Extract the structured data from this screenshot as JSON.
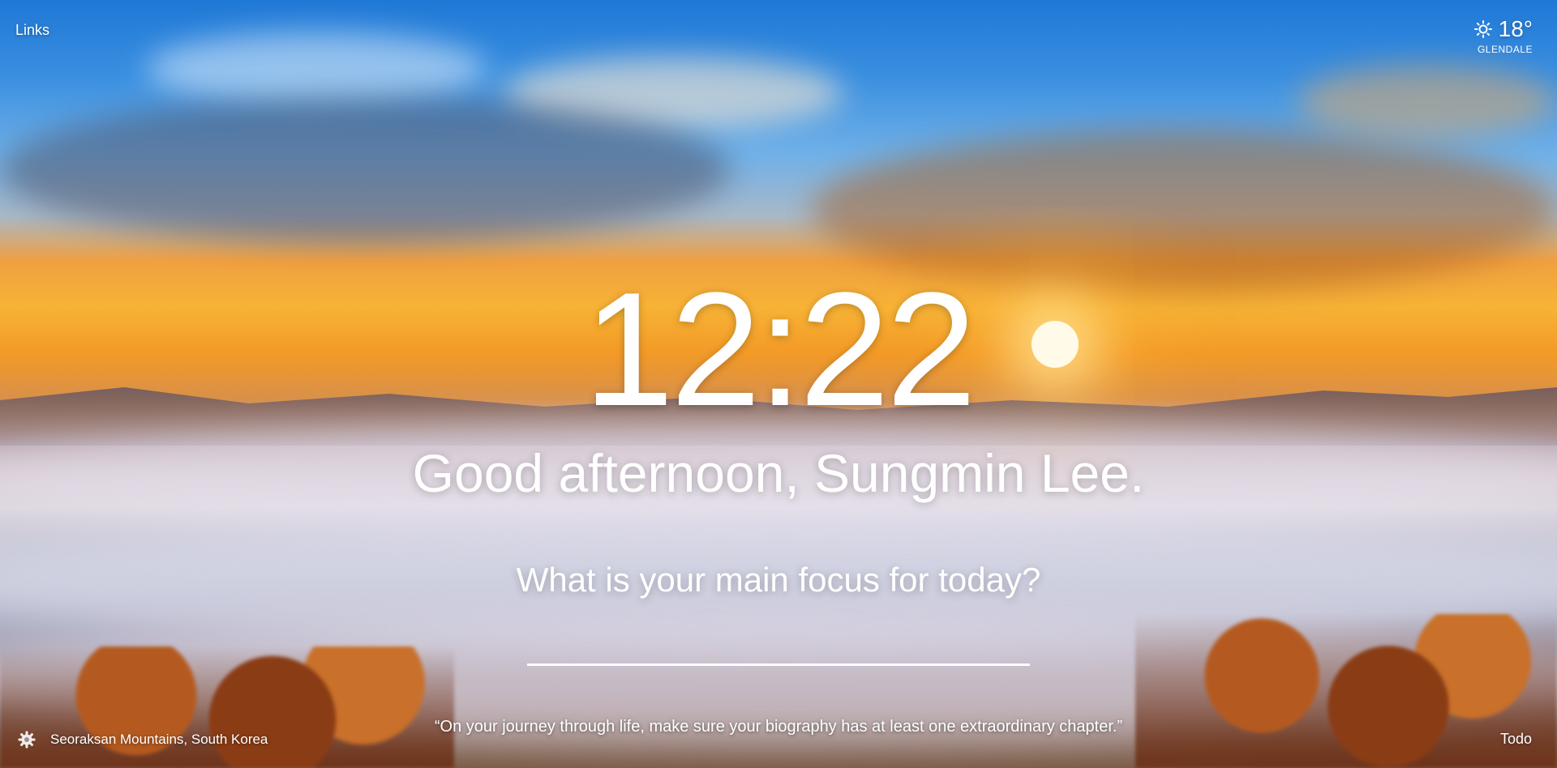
{
  "top_left": {
    "links_label": "Links"
  },
  "weather": {
    "icon": "sun-icon",
    "temperature": "18°",
    "location": "GLENDALE"
  },
  "main": {
    "clock": "12:22",
    "greeting": "Good afternoon, Sungmin Lee.",
    "focus_prompt": "What is your main focus for today?",
    "focus_input_value": ""
  },
  "bottom": {
    "settings_icon": "gear-icon",
    "photo_location": "Seoraksan Mountains, South Korea",
    "quote": "“On your journey through life, make sure your biography has at least one extraordinary chapter.”",
    "todo_label": "Todo"
  },
  "colors": {
    "text": "#ffffff",
    "sky_top": "#1f78d6",
    "sunset": "#f7b335"
  }
}
